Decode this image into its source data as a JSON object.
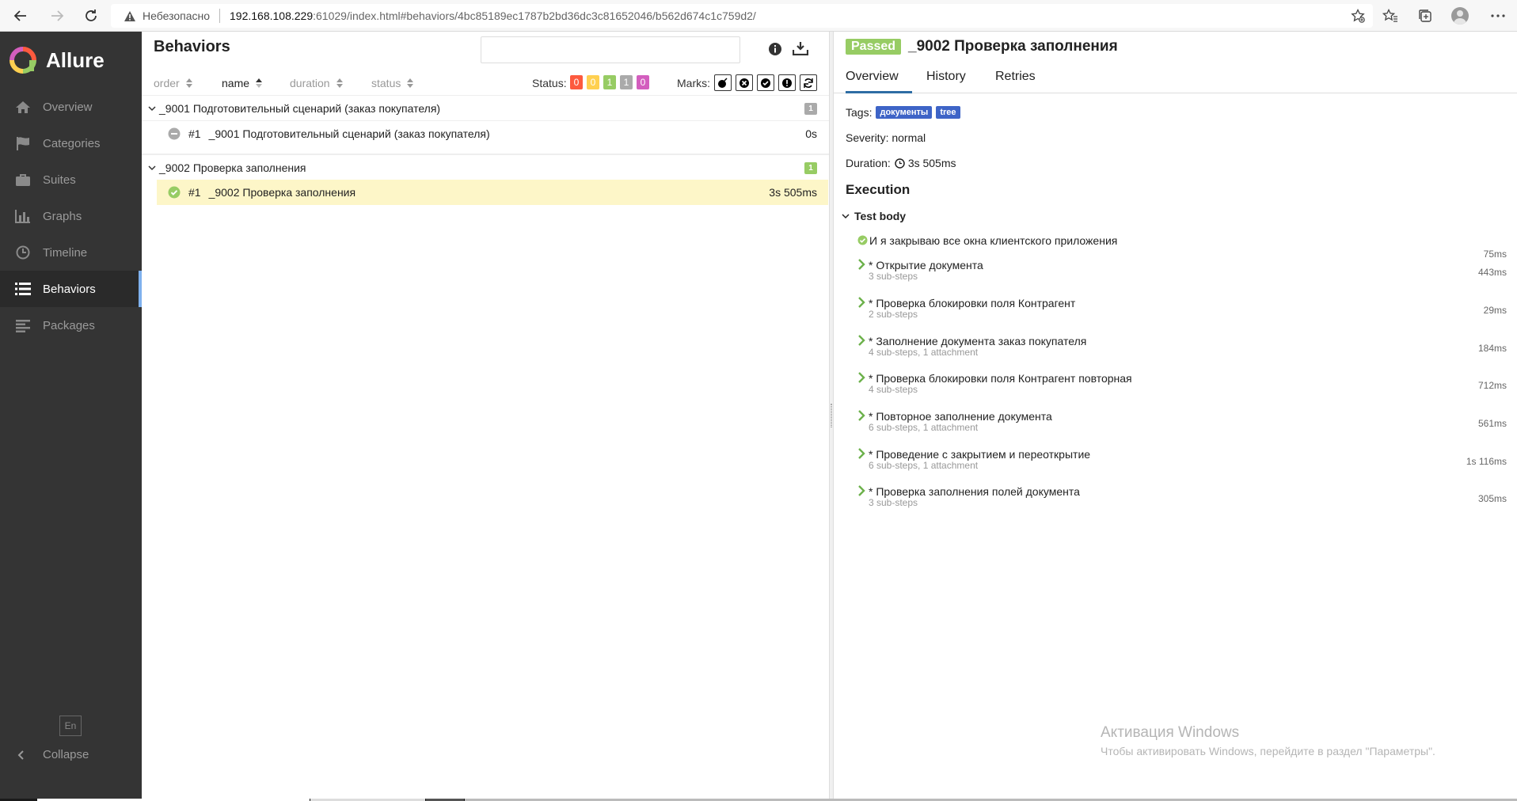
{
  "browser": {
    "insecure_label": "Небезопасно",
    "url_host": "192.168.108.229",
    "url_rest": ":61029/index.html#behaviors/4bc85189ec1787b2bd36dc3c81652046/b562d674c1c759d2/"
  },
  "sidebar": {
    "brand": "Allure",
    "items": [
      {
        "label": "Overview",
        "icon": "home-icon"
      },
      {
        "label": "Categories",
        "icon": "flag-icon"
      },
      {
        "label": "Suites",
        "icon": "briefcase-icon"
      },
      {
        "label": "Graphs",
        "icon": "bar-chart-icon"
      },
      {
        "label": "Timeline",
        "icon": "clock-icon"
      },
      {
        "label": "Behaviors",
        "icon": "list-icon",
        "active": true
      },
      {
        "label": "Packages",
        "icon": "align-left-icon"
      }
    ],
    "lang": "En",
    "collapse": "Collapse"
  },
  "behaviors": {
    "title": "Behaviors",
    "search_placeholder": "",
    "sort": {
      "order": "order",
      "name": "name",
      "duration": "duration",
      "status": "status"
    },
    "status_label": "Status:",
    "status_counts": [
      {
        "value": "0",
        "color": "#fd5a3e"
      },
      {
        "value": "0",
        "color": "#ffd050"
      },
      {
        "value": "1",
        "color": "#97cc64"
      },
      {
        "value": "1",
        "color": "#aaaaaa"
      },
      {
        "value": "0",
        "color": "#d35ebe"
      }
    ],
    "marks_label": "Marks:",
    "groups": [
      {
        "name": "_9001 Подготовительный сценарий (заказ покупателя)",
        "count": "1",
        "count_color": "#aaaaaa",
        "rows": [
          {
            "num": "#1",
            "name": "_9001 Подготовительный сценарий (заказ покупателя)",
            "duration": "0s",
            "status": "skipped"
          }
        ]
      },
      {
        "name": "_9002 Проверка заполнения",
        "count": "1",
        "count_color": "#97cc64",
        "rows": [
          {
            "num": "#1",
            "name": "_9002 Проверка заполнения",
            "duration": "3s 505ms",
            "status": "passed",
            "selected": true
          }
        ]
      }
    ]
  },
  "test": {
    "status": "Passed",
    "title": "_9002 Проверка заполнения",
    "tabs": [
      "Overview",
      "History",
      "Retries"
    ],
    "tags_label": "Tags:",
    "tags": [
      "документы",
      "tree"
    ],
    "severity": "Severity: normal",
    "duration_label": "Duration:",
    "duration": "3s 505ms",
    "execution_title": "Execution",
    "body_title": "Test body",
    "steps": [
      {
        "name": "И я закрываю все окна клиентского приложения",
        "sub": "",
        "duration": "75ms",
        "kind": "check"
      },
      {
        "name": "* Открытие документа",
        "sub": "3 sub-steps",
        "duration": "443ms",
        "kind": "expand"
      },
      {
        "name": "* Проверка блокировки поля Контрагент",
        "sub": "2 sub-steps",
        "duration": "29ms",
        "kind": "expand"
      },
      {
        "name": "* Заполнение документа заказ покупателя",
        "sub": "4 sub-steps, 1 attachment",
        "duration": "184ms",
        "kind": "expand"
      },
      {
        "name": "* Проверка блокировки поля Контрагент повторная",
        "sub": "4 sub-steps",
        "duration": "712ms",
        "kind": "expand"
      },
      {
        "name": "* Повторное заполнение документа",
        "sub": "6 sub-steps, 1 attachment",
        "duration": "561ms",
        "kind": "expand"
      },
      {
        "name": "* Проведение с закрытием и переоткрытие",
        "sub": "6 sub-steps, 1 attachment",
        "duration": "1s 116ms",
        "kind": "expand"
      },
      {
        "name": "* Проверка заполнения полей документа",
        "sub": "3 sub-steps",
        "duration": "305ms",
        "kind": "expand"
      }
    ]
  },
  "watermark": {
    "line1": "Активация Windows",
    "line2": "Чтобы активировать Windows, перейдите в раздел \"Параметры\"."
  }
}
